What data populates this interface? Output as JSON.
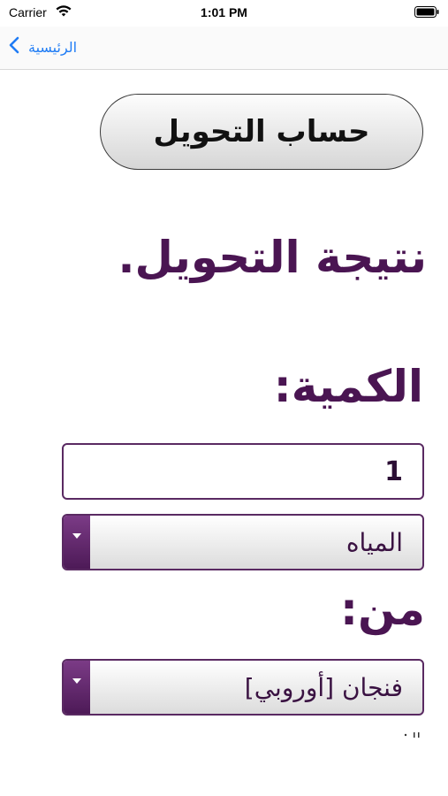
{
  "status_bar": {
    "carrier": "Carrier",
    "time": "1:01 PM",
    "icons": [
      "wifi-icon",
      "battery-icon"
    ]
  },
  "nav": {
    "back_label": "الرئيسية",
    "accent_color": "#1f7cf5"
  },
  "convert_button_label": "حساب التحويل",
  "result_title": "نتيجة التحويل.",
  "quantity": {
    "label": "الكمية:",
    "value": "1"
  },
  "unit_type_select": {
    "value": "المياه"
  },
  "from": {
    "label": "من:",
    "select_value": "فنجان [أوروبي]"
  },
  "colors": {
    "primary_purple": "#4a1552",
    "border_purple": "#5a2a62"
  }
}
